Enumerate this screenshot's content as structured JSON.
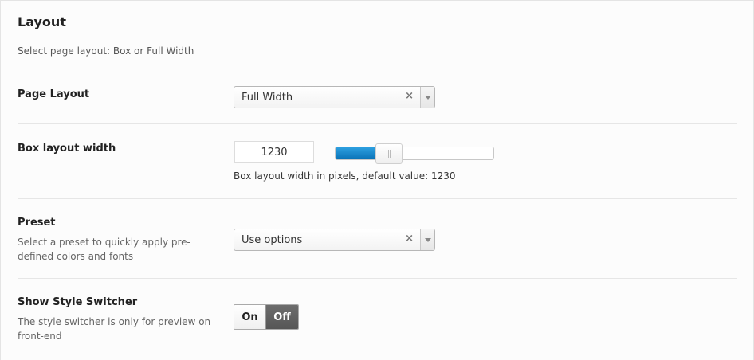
{
  "section": {
    "title": "Layout",
    "description": "Select page layout: Box or Full Width"
  },
  "page_layout": {
    "label": "Page Layout",
    "selected": "Full Width",
    "clear_glyph": "×"
  },
  "box_width": {
    "label": "Box layout width",
    "value": "1230",
    "slider_fraction": 0.25,
    "hint": "Box layout width in pixels, default value: 1230"
  },
  "preset": {
    "label": "Preset",
    "description": "Select a preset to quickly apply pre-defined colors and fonts",
    "selected": "Use options",
    "clear_glyph": "×"
  },
  "style_switcher": {
    "label": "Show Style Switcher",
    "description": "The style switcher is only for preview on front-end",
    "on_label": "On",
    "off_label": "Off",
    "state": "off"
  },
  "colors": {
    "accent": "#0a73b7",
    "toggle_active": "#5f5f5f"
  }
}
